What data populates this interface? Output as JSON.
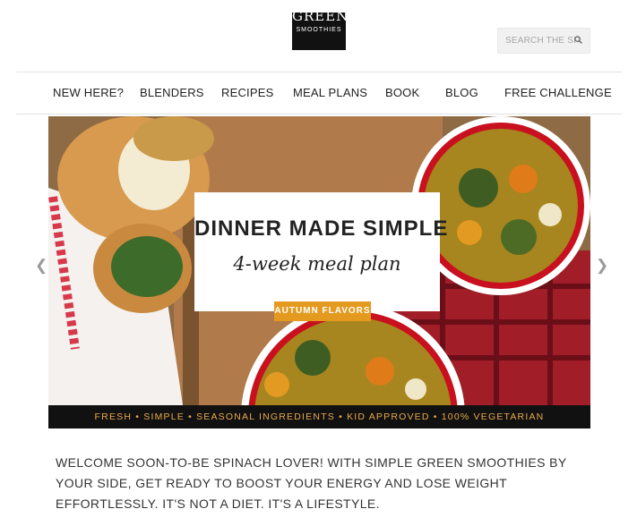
{
  "header": {
    "logo": {
      "line1": "GREEN",
      "line2": "SMOOTHIES"
    },
    "search": {
      "placeholder": "SEARCH THE SITE",
      "icon": "search-icon"
    }
  },
  "nav": {
    "items": [
      {
        "label": "NEW HERE?"
      },
      {
        "label": "BLENDERS"
      },
      {
        "label": "RECIPES"
      },
      {
        "label": "MEAL PLANS"
      },
      {
        "label": "BOOK"
      },
      {
        "label": "BLOG"
      },
      {
        "label": "FREE CHALLENGE"
      }
    ]
  },
  "hero": {
    "title": "DINNER MADE SIMPLE",
    "subtitle": "4-week meal plan",
    "cta_label": "AUTUMN FLAVORS",
    "prev_icon": "chevron-left-icon",
    "next_icon": "chevron-right-icon",
    "tagline": "FRESH  •  SIMPLE  •  SEASONAL INGREDIENTS  •  KID APPROVED  •  100% VEGETARIAN"
  },
  "welcome": {
    "text": "WELCOME SOON-TO-BE SPINACH LOVER! WITH SIMPLE GREEN SMOOTHIES BY YOUR SIDE, GET READY TO BOOST YOUR ENERGY AND LOSE WEIGHT EFFORTLESSLY. IT'S NOT A DIET. IT'S A LIFESTYLE."
  },
  "colors": {
    "accent": "#e49a1e",
    "tagline_text": "#e9a94a",
    "strip_bg": "#111111"
  }
}
